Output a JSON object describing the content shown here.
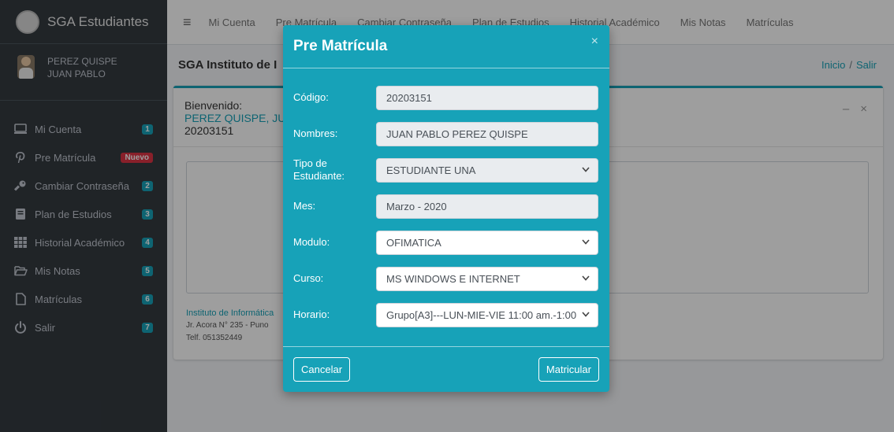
{
  "brand": {
    "text": "SGA Estudiantes"
  },
  "user": {
    "name_line1": "PEREZ QUISPE",
    "name_line2": "JUAN PABLO"
  },
  "sidebar": {
    "items": [
      {
        "label": "Mi Cuenta",
        "badge": "1",
        "icon": "monitor-icon"
      },
      {
        "label": "Pre Matrícula",
        "badge": "Nuevo",
        "icon": "pinterest-p-icon"
      },
      {
        "label": "Cambiar Contraseña",
        "badge": "2",
        "icon": "key-icon"
      },
      {
        "label": "Plan de Estudios",
        "badge": "3",
        "icon": "book-icon"
      },
      {
        "label": "Historial Académico",
        "badge": "4",
        "icon": "grid-table-icon"
      },
      {
        "label": "Mis Notas",
        "badge": "5",
        "icon": "folder-open-icon"
      },
      {
        "label": "Matrículas",
        "badge": "6",
        "icon": "file-icon"
      },
      {
        "label": "Salir",
        "badge": "7",
        "icon": "power-icon"
      }
    ]
  },
  "topnav": {
    "links": [
      "Mi Cuenta",
      "Pre Matrícula",
      "Cambiar Contraseña",
      "Plan de Estudios",
      "Historial Académico",
      "Mis Notas",
      "Matrículas"
    ]
  },
  "header": {
    "title": "SGA Instituto de I",
    "breadcrumb_home": "Inicio",
    "breadcrumb_sep": "/",
    "breadcrumb_exit": "Salir"
  },
  "card": {
    "welcome": "Bienvenido:",
    "student_name": "PEREZ QUISPE, JUA",
    "student_code": "20203151",
    "minimize_symbol": "–",
    "close_symbol": "×",
    "footer_title": "Instituto de Informática",
    "footer_address": "Jr. Acora N° 235 - Puno",
    "footer_phone": "Telf. 051352449"
  },
  "modal": {
    "title": "Pre Matrícula",
    "close_symbol": "×",
    "fields": {
      "codigo_label": "Código:",
      "codigo_value": "20203151",
      "nombres_label": "Nombres:",
      "nombres_value": "JUAN PABLO PEREZ QUISPE",
      "tipo_label": "Tipo de Estudiante:",
      "tipo_value": "ESTUDIANTE UNA",
      "mes_label": "Mes:",
      "mes_value": "Marzo - 2020",
      "modulo_label": "Modulo:",
      "modulo_value": "OFIMATICA",
      "curso_label": "Curso:",
      "curso_value": "MS WINDOWS E INTERNET",
      "horario_label": "Horario:",
      "horario_value": "Grupo[A3]---LUN-MIE-VIE 11:00 am.-1:00"
    },
    "cancel_label": "Cancelar",
    "submit_label": "Matricular"
  },
  "colors": {
    "accent": "#17a2b8",
    "sidebar_bg": "#343a40",
    "badge_new": "#dc3545"
  }
}
